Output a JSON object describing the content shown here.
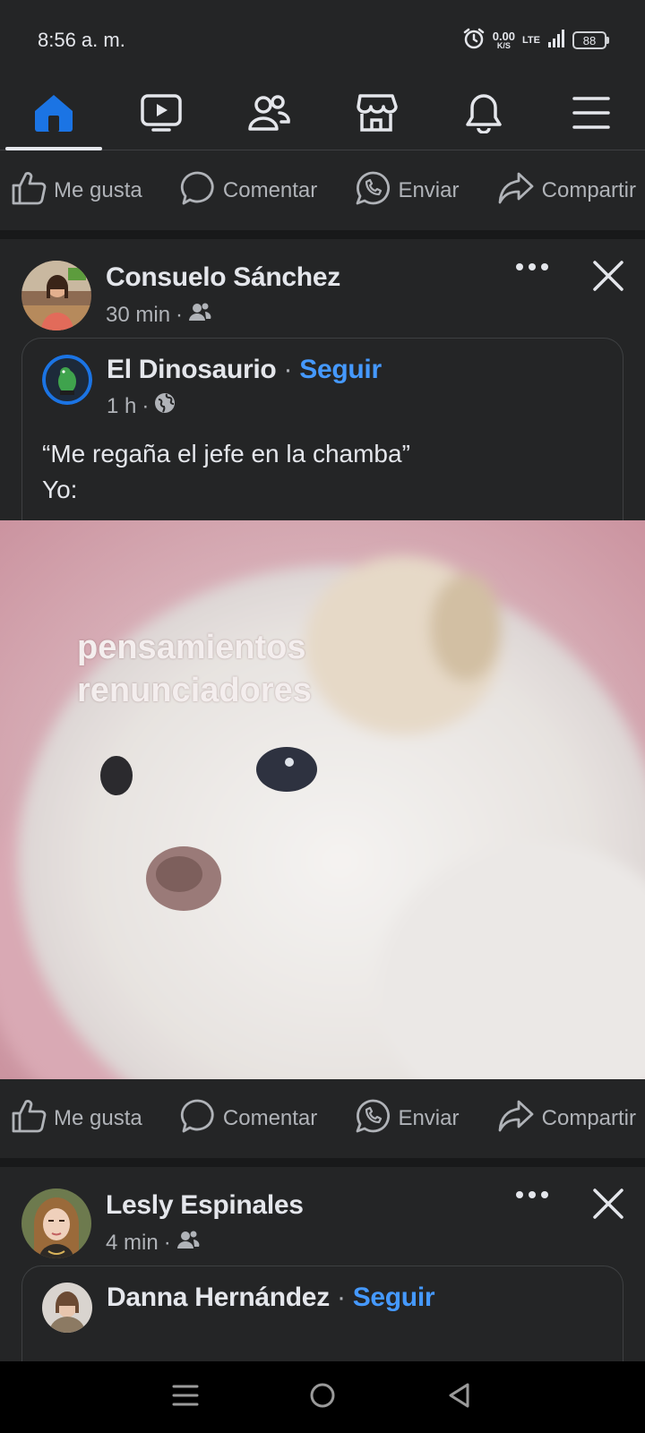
{
  "status_bar": {
    "time": "8:56 a. m.",
    "net_speed": "0.00",
    "net_unit": "K/S",
    "network": "LTE",
    "battery": "88",
    "icons": [
      "alarm-icon",
      "signal-icon"
    ]
  },
  "nav": {
    "tabs": [
      "home-icon",
      "video-icon",
      "friends-icon",
      "marketplace-icon",
      "notifications-icon",
      "menu-icon"
    ],
    "active": "home-icon",
    "accent": "#1b74e4"
  },
  "actions": {
    "like": "Me gusta",
    "comment": "Comentar",
    "send": "Enviar",
    "share": "Compartir"
  },
  "posts": [
    {
      "author": "Consuelo Sánchez",
      "time": "30 min",
      "audience_icon": "friends-icon",
      "shared": {
        "page": "El Dinosaurio",
        "separator": "·",
        "follow": "Seguir",
        "time": "1 h",
        "audience_icon": "globe-icon",
        "caption_line1": "“Me regaña el jefe en la chamba”",
        "caption_line2": "Yo:",
        "image_text_line1": "pensamientos",
        "image_text_line2": "renunciadores"
      }
    },
    {
      "author": "Lesly Espinales",
      "time": "4 min",
      "audience_icon": "friends-icon",
      "shared": {
        "page": "Danna Hernández",
        "separator": "·",
        "follow": "Seguir"
      }
    }
  ],
  "colors": {
    "background": "#242526",
    "text": "#e4e6eb",
    "secondary": "#b0b3b8",
    "link": "#4599ff"
  }
}
